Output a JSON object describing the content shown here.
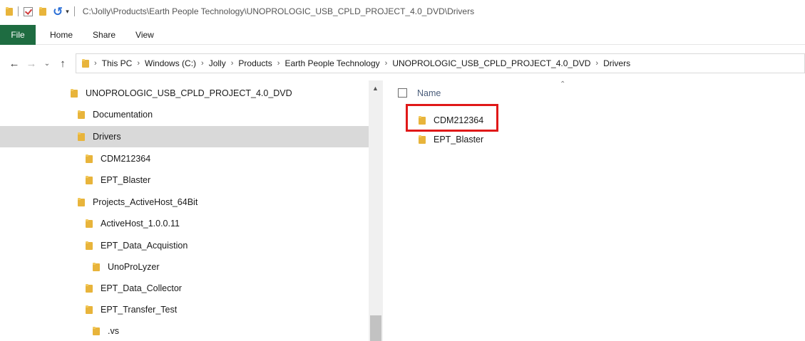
{
  "titlebar": {
    "path": "C:\\Jolly\\Products\\Earth People Technology\\UNOPROLOGIC_USB_CPLD_PROJECT_4.0_DVD\\Drivers"
  },
  "ribbon": {
    "file": "File",
    "tabs": [
      "Home",
      "Share",
      "View"
    ]
  },
  "address": {
    "crumbs": [
      "This PC",
      "Windows (C:)",
      "Jolly",
      "Products",
      "Earth People Technology",
      "UNOPROLOGIC_USB_CPLD_PROJECT_4.0_DVD",
      "Drivers"
    ]
  },
  "tree": {
    "items": [
      {
        "label": "UNOPROLOGIC_USB_CPLD_PROJECT_4.0_DVD"
      },
      {
        "label": "Documentation"
      },
      {
        "label": "Drivers",
        "selected": true
      },
      {
        "label": "CDM212364"
      },
      {
        "label": "EPT_Blaster"
      },
      {
        "label": "Projects_ActiveHost_64Bit"
      },
      {
        "label": "ActiveHost_1.0.0.11"
      },
      {
        "label": "EPT_Data_Acquistion"
      },
      {
        "label": "UnoProLyzer"
      },
      {
        "label": "EPT_Data_Collector"
      },
      {
        "label": "EPT_Transfer_Test"
      },
      {
        "label": ".vs"
      }
    ]
  },
  "content": {
    "column_name": "Name",
    "items": [
      {
        "label": "CDM212364",
        "highlighted": true
      },
      {
        "label": "EPT_Blaster"
      }
    ]
  },
  "colors": {
    "file_tab": "#1e6c41",
    "folder": "#e8b43b",
    "selection": "#d9d9d9",
    "highlight_box": "#e01818"
  },
  "icons": {
    "folder": "folder-icon",
    "back": "back-arrow-icon",
    "forward": "forward-arrow-icon",
    "recent": "chevron-down-icon",
    "up": "up-arrow-icon"
  }
}
